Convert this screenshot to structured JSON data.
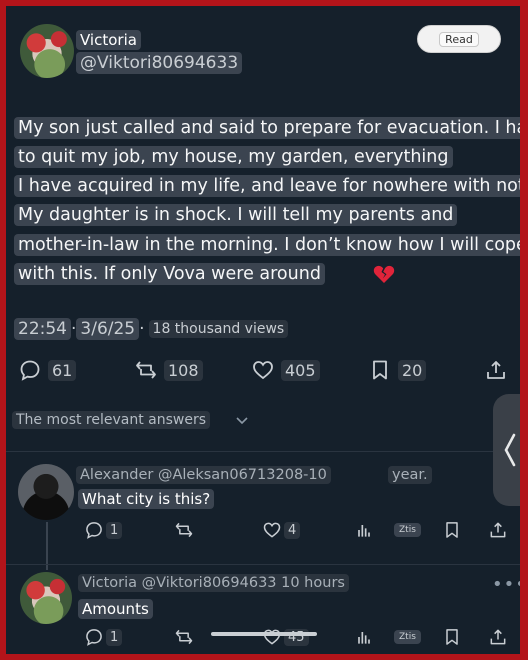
{
  "post": {
    "author_name": "Victoria",
    "author_handle": "@Viktori80694633",
    "read_button": "Read",
    "lines": [
      "My son just called and said to prepare for evacuation. I have",
      "to quit my job, my house, my garden, everything",
      "I have acquired in my life, and leave for nowhere with nothing.",
      "My daughter is in shock. I will tell my parents and",
      "mother-in-law in the morning. I don’t know how I will cope",
      "with this. If only Vova were around"
    ],
    "emoji": "broken-heart-icon",
    "time": "22:54",
    "date": "3/6/25",
    "views": "18 thousand views",
    "counts": {
      "replies": "61",
      "reposts": "108",
      "likes": "405",
      "bookmarks": "20"
    }
  },
  "sort_label": "The most relevant answers",
  "replies": [
    {
      "header": "Alexander @Aleksan06713208-10",
      "age": "year.",
      "text": "What city is this?",
      "counts": {
        "replies": "1",
        "likes": "4"
      },
      "stats_label": "Ztis"
    },
    {
      "header": "Victoria @Viktori80694633 10 hours",
      "text": "Amounts",
      "counts": {
        "replies": "1",
        "likes": "45"
      },
      "stats_label": "Ztis",
      "more": "•••"
    }
  ],
  "colors": {
    "background": "#15202b",
    "frame": "#b3141a",
    "highlight": "#3b4450",
    "emoji_red": "#e0243a"
  }
}
